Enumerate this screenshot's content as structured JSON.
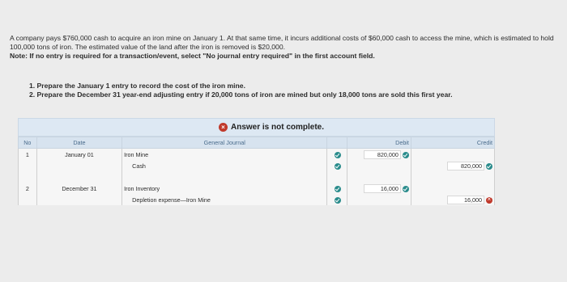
{
  "problem": {
    "text": "A company pays $760,000 cash to acquire an iron mine on January 1. At that same time, it incurs additional costs of $60,000 cash to access the mine, which is estimated to hold 100,000 tons of iron. The estimated value of the land after the iron is removed is $20,000.",
    "note": "Note: If no entry is required for a transaction/event, select \"No journal entry required\" in the first account field."
  },
  "requirements": [
    "1. Prepare the January 1 entry to record the cost of the iron mine.",
    "2. Prepare the December 31 year-end adjusting entry if 20,000 tons of iron are mined but only 18,000 tons are sold this first year."
  ],
  "banner": {
    "status": "Answer is not complete."
  },
  "table": {
    "headers": {
      "no": "No",
      "date": "Date",
      "journal": "General Journal",
      "debit": "Debit",
      "credit": "Credit"
    },
    "rows": [
      {
        "no": "1",
        "date": "January 01",
        "account": "Iron Mine",
        "debit": "820,000",
        "credit": "",
        "status": "correct",
        "amount_status": "correct"
      },
      {
        "no": "",
        "date": "",
        "account": "Cash",
        "debit": "",
        "credit": "820,000",
        "status": "correct",
        "amount_status": "correct"
      },
      {
        "no": "2",
        "date": "December 31",
        "account": "Iron Inventory",
        "debit": "16,000",
        "credit": "",
        "status": "correct",
        "amount_status": "correct"
      },
      {
        "no": "",
        "date": "",
        "account": "Depletion expense—Iron Mine",
        "debit": "",
        "credit": "16,000",
        "status": "correct",
        "amount_status": "incorrect"
      }
    ]
  },
  "colors": {
    "correct": "#2a8c8c",
    "incorrect": "#c0392b",
    "header_bg": "#d7e3ef"
  }
}
